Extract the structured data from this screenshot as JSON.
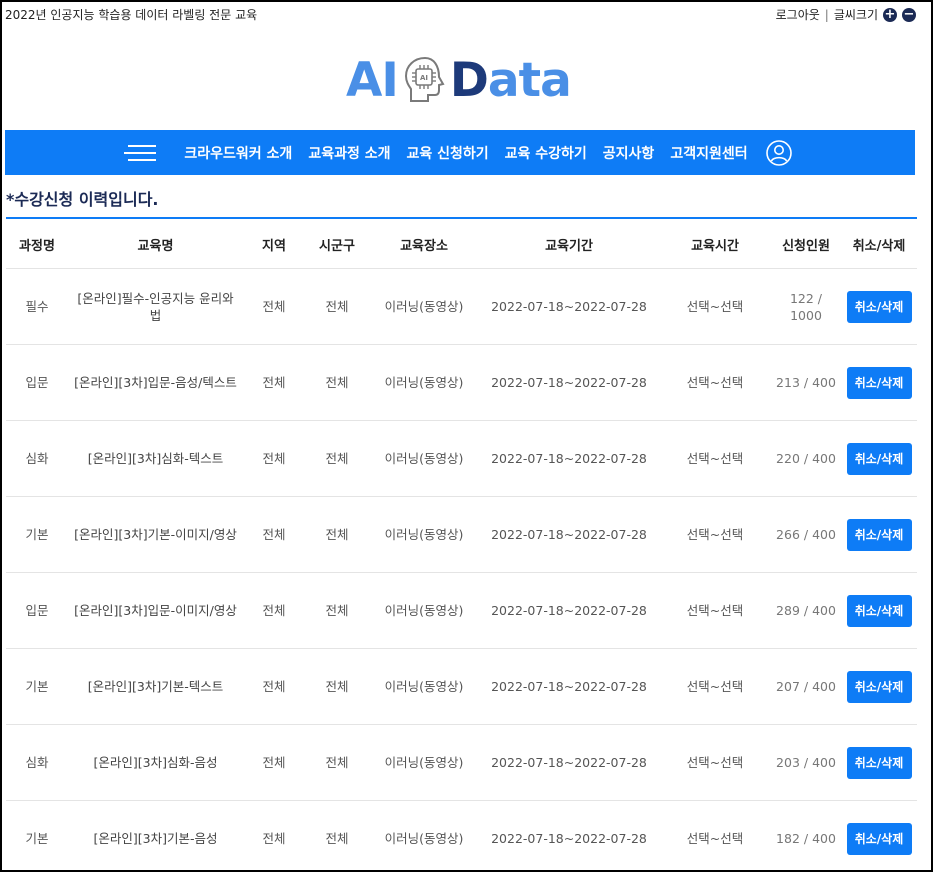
{
  "topbar": {
    "site_title": "2022년 인공지능 학습용 데이터 라벨링 전문 교육",
    "logout": "로그아웃",
    "separator": "|",
    "font_size_label": "글씨크기",
    "font_increase_icon": "+",
    "font_decrease_icon": "−"
  },
  "logo": {
    "ai": "AI",
    "data_first": "D",
    "data_rest": "ata",
    "chip_text": "AI"
  },
  "nav": {
    "items": [
      "크라우드워커 소개",
      "교육과정 소개",
      "교육 신청하기",
      "교육 수강하기",
      "공지사항",
      "고객지원센터"
    ]
  },
  "section_title": "*수강신청 이력입니다.",
  "table": {
    "headers": [
      "과정명",
      "교육명",
      "지역",
      "시군구",
      "교육장소",
      "교육기간",
      "교육시간",
      "신청인원",
      "취소/삭제"
    ],
    "rows": [
      {
        "course": "필수",
        "name": "[온라인]필수-인공지능 윤리와 법",
        "region": "전체",
        "district": "전체",
        "place": "이러닝(동영상)",
        "period": "2022-07-18~2022-07-28",
        "time": "선택~선택",
        "count": "122 / 1000",
        "action": "취소/삭제"
      },
      {
        "course": "입문",
        "name": "[온라인][3차]입문-음성/텍스트",
        "region": "전체",
        "district": "전체",
        "place": "이러닝(동영상)",
        "period": "2022-07-18~2022-07-28",
        "time": "선택~선택",
        "count": "213 / 400",
        "action": "취소/삭제"
      },
      {
        "course": "심화",
        "name": "[온라인][3차]심화-텍스트",
        "region": "전체",
        "district": "전체",
        "place": "이러닝(동영상)",
        "period": "2022-07-18~2022-07-28",
        "time": "선택~선택",
        "count": "220 / 400",
        "action": "취소/삭제"
      },
      {
        "course": "기본",
        "name": "[온라인][3차]기본-이미지/영상",
        "region": "전체",
        "district": "전체",
        "place": "이러닝(동영상)",
        "period": "2022-07-18~2022-07-28",
        "time": "선택~선택",
        "count": "266 / 400",
        "action": "취소/삭제"
      },
      {
        "course": "입문",
        "name": "[온라인][3차]입문-이미지/영상",
        "region": "전체",
        "district": "전체",
        "place": "이러닝(동영상)",
        "period": "2022-07-18~2022-07-28",
        "time": "선택~선택",
        "count": "289 / 400",
        "action": "취소/삭제"
      },
      {
        "course": "기본",
        "name": "[온라인][3차]기본-텍스트",
        "region": "전체",
        "district": "전체",
        "place": "이러닝(동영상)",
        "period": "2022-07-18~2022-07-28",
        "time": "선택~선택",
        "count": "207 / 400",
        "action": "취소/삭제"
      },
      {
        "course": "심화",
        "name": "[온라인][3차]심화-음성",
        "region": "전체",
        "district": "전체",
        "place": "이러닝(동영상)",
        "period": "2022-07-18~2022-07-28",
        "time": "선택~선택",
        "count": "203 / 400",
        "action": "취소/삭제"
      },
      {
        "course": "기본",
        "name": "[온라인][3차]기본-음성",
        "region": "전체",
        "district": "전체",
        "place": "이러닝(동영상)",
        "period": "2022-07-18~2022-07-28",
        "time": "선택~선택",
        "count": "182 / 400",
        "action": "취소/삭제"
      }
    ]
  },
  "colors": {
    "primary": "#0e7cf6",
    "navy": "#1b2a55",
    "logo_blue": "#4a8fe6",
    "logo_navy": "#1d3a7a"
  }
}
